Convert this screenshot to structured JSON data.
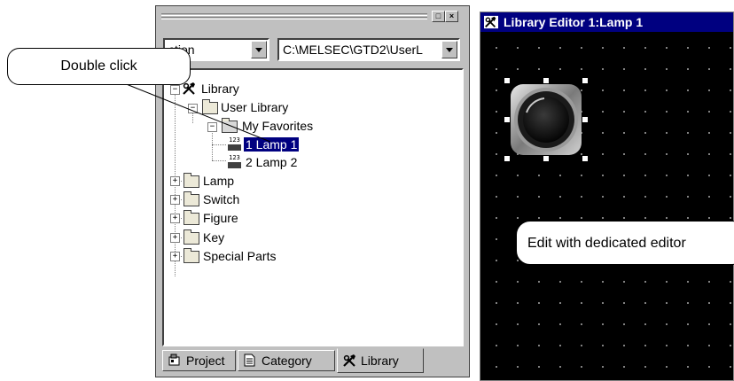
{
  "library_panel": {
    "filter_value": "ction",
    "path_value": "C:\\MELSEC\\GTD2\\UserL",
    "tree": {
      "root": "Library",
      "user_library": "User Library",
      "my_favorites": "My Favorites",
      "items": [
        {
          "number_glyph": "123",
          "label": "1 Lamp 1"
        },
        {
          "number_glyph": "123",
          "label": "2 Lamp 2"
        }
      ],
      "categories": [
        "Lamp",
        "Switch",
        "Figure",
        "Key",
        "Special Parts"
      ]
    },
    "tabs": {
      "project": "Project",
      "category": "Category",
      "library": "Library"
    },
    "window_buttons": {
      "restore": "□",
      "close": "×"
    }
  },
  "editor": {
    "title": "Library Editor 1:Lamp 1"
  },
  "callouts": {
    "double_click": "Double click",
    "edit": "Edit with dedicated editor"
  }
}
